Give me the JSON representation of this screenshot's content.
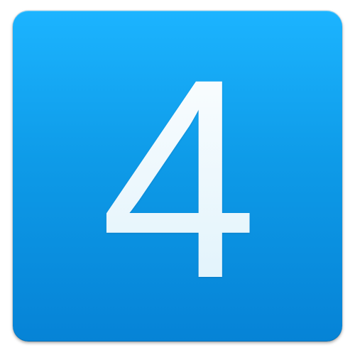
{
  "app_icon": {
    "glyph_text": "4",
    "icon_name": "numeral-four-app-icon",
    "colors": {
      "tile_top": "#1cb4ff",
      "tile_bottom": "#0683d6",
      "glyph_top": "#ffffff",
      "glyph_bottom": "#dcf1fb"
    }
  }
}
